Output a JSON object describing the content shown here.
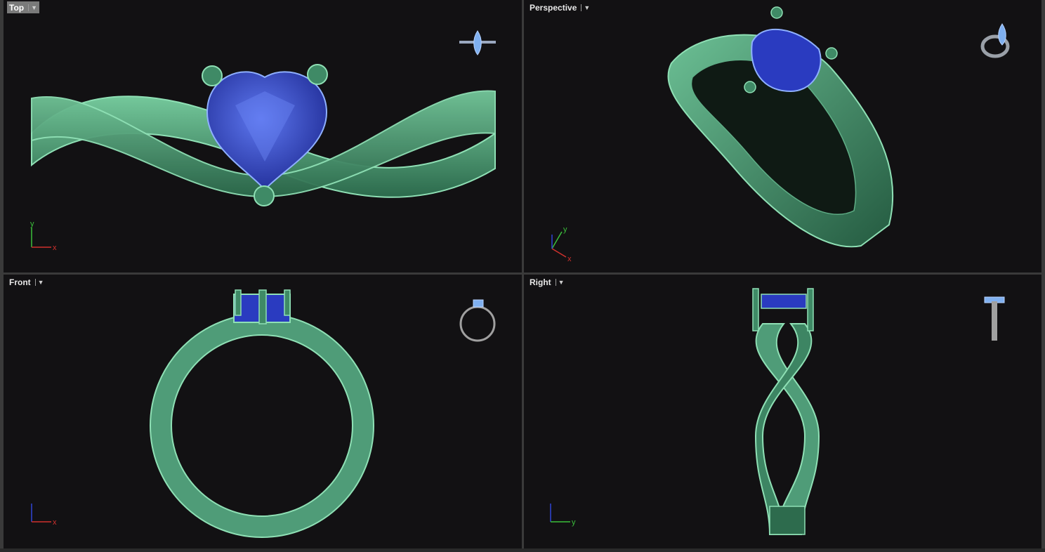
{
  "viewports": [
    {
      "id": "top",
      "title": "Top",
      "active": true,
      "axes": [
        "y",
        "x"
      ]
    },
    {
      "id": "perspective",
      "title": "Perspective",
      "active": false,
      "axes": [
        "y",
        "x"
      ]
    },
    {
      "id": "front",
      "title": "Front",
      "active": false,
      "axes": [
        "x"
      ]
    },
    {
      "id": "right",
      "title": "Right",
      "active": false,
      "axes": [
        "y"
      ]
    }
  ],
  "colors": {
    "background": "#121113",
    "metal": "#4f9c78",
    "metal_edge": "#7fd6a8",
    "gem": "#2a3bc0",
    "gem_light": "#6a86ff",
    "axis_x": "#d0312d",
    "axis_y": "#3bbf3b",
    "axis_z": "#2f45d6"
  },
  "icons": {
    "dropdown": "chevron-down-icon",
    "preview": "ring-preview-icon"
  }
}
